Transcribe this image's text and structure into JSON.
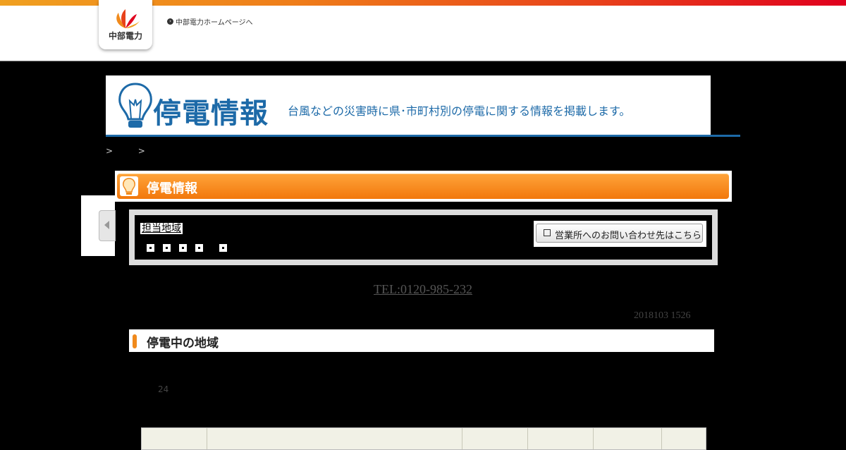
{
  "header": {
    "company": "中部電力",
    "home_link": "中部電力ホームページへ"
  },
  "banner": {
    "title": "停電情報",
    "subtitle": "台風などの災害時に県･市町村別の停電に関する情報を掲載します。"
  },
  "breadcrumb": {
    "prefix": ">",
    "link": "",
    "suffix": ">"
  },
  "page": {
    "heading": "停電情報"
  },
  "region": {
    "label": "担当地域",
    "contact_button": "営業所へのお問い合わせ先はこちら"
  },
  "contact": {
    "tel": "TEL:0120-985-232"
  },
  "status": {
    "updated": "2018103 1526"
  },
  "outage": {
    "heading": "停電中の地域",
    "count": "24"
  },
  "colors": {
    "brand_blue": "#1d6aa8",
    "accent_orange": "#f2780c"
  }
}
